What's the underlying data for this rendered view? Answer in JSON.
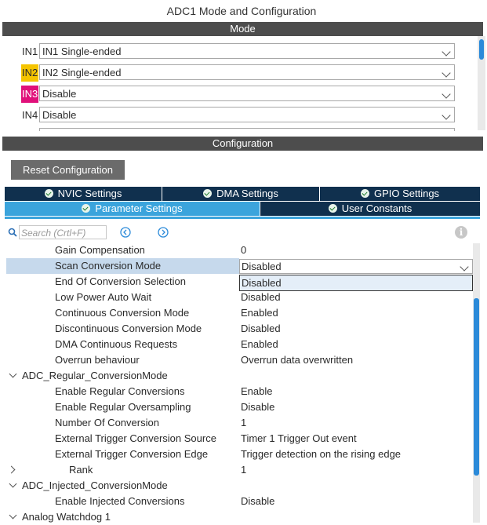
{
  "window_title": "ADC1 Mode and Configuration",
  "mode_section": {
    "header": "Mode",
    "rows": [
      {
        "label": "IN1",
        "value": "IN1 Single-ended",
        "highlight": ""
      },
      {
        "label": "IN2",
        "value": "IN2 Single-ended",
        "highlight": "#f5c400"
      },
      {
        "label": "IN3",
        "value": "Disable",
        "highlight": "#e0107a"
      },
      {
        "label": "IN4",
        "value": "Disable",
        "highlight": ""
      }
    ]
  },
  "config_section": {
    "header": "Configuration",
    "reset_button": "Reset Configuration",
    "tabs_row1": [
      "NVIC Settings",
      "DMA Settings",
      "GPIO Settings"
    ],
    "tabs_row2": [
      "Parameter Settings",
      "User Constants"
    ],
    "search_placeholder": "Search (Crtl+F)"
  },
  "params": {
    "gain_compensation": {
      "name": "Gain Compensation",
      "value": "0"
    },
    "scan_conversion_mode": {
      "name": "Scan Conversion Mode",
      "value": "Disabled"
    },
    "dropdown_option": "Disabled",
    "end_of_conversion": {
      "name": "End Of Conversion Selection"
    },
    "low_power_auto_wait": {
      "name": "Low Power Auto Wait",
      "value": "Disabled"
    },
    "continuous_conversion": {
      "name": "Continuous Conversion Mode",
      "value": "Enabled"
    },
    "discontinuous_conversion": {
      "name": "Discontinuous Conversion Mode",
      "value": "Disabled"
    },
    "dma_continuous_requests": {
      "name": "DMA Continuous Requests",
      "value": "Enabled"
    },
    "overrun_behaviour": {
      "name": "Overrun behaviour",
      "value": "Overrun data overwritten"
    },
    "regular_group": "ADC_Regular_ConversionMode",
    "enable_regular_conversions": {
      "name": "Enable Regular Conversions",
      "value": "Enable"
    },
    "enable_regular_oversampling": {
      "name": "Enable Regular Oversampling",
      "value": "Disable"
    },
    "number_of_conversion": {
      "name": "Number Of Conversion",
      "value": "1"
    },
    "ext_trigger_source": {
      "name": "External Trigger Conversion Source",
      "value": "Timer 1 Trigger Out event"
    },
    "ext_trigger_edge": {
      "name": "External Trigger Conversion Edge",
      "value": "Trigger detection on the rising edge"
    },
    "rank": {
      "name": "Rank",
      "value": "1"
    },
    "injected_group": "ADC_Injected_ConversionMode",
    "enable_injected_conversions": {
      "name": "Enable Injected Conversions",
      "value": "Disable"
    },
    "analog_watchdog_group": "Analog Watchdog 1"
  },
  "colors": {
    "accent": "#3ba4dc",
    "tab_dark": "#10304e",
    "section_header": "#4d4d4d",
    "selected_row": "#c6d9ec"
  }
}
